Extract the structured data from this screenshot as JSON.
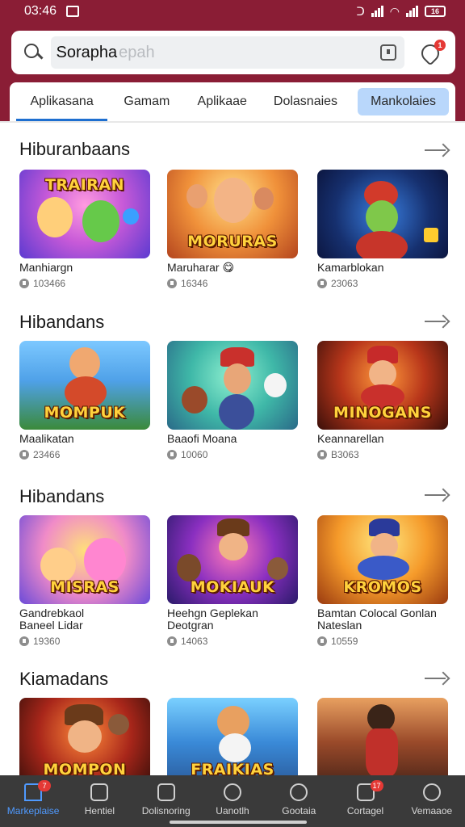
{
  "status_bar": {
    "time": "03:46",
    "battery": "16"
  },
  "search": {
    "value": "Sorapha",
    "placeholder": "epah",
    "notif_count": "1"
  },
  "tabs": [
    "Aplikasana",
    "Gamam",
    "Aplikaae",
    "Dolasnaies",
    "Mankolaies"
  ],
  "sections": [
    {
      "title": "Hiburanbaans",
      "cards": [
        {
          "name": "Manhiargn",
          "count": "103466",
          "art": "TRAIRAN"
        },
        {
          "name": "Maruharar 😋",
          "count": "16346",
          "art": "MORURAS"
        },
        {
          "name": "Kamarblokan",
          "count": "23063",
          "art": ""
        }
      ]
    },
    {
      "title": "Hibandans",
      "cards": [
        {
          "name": "Maalikatan",
          "count": "23466",
          "art": "MOMPUK"
        },
        {
          "name": "Baaofi Moana",
          "count": "10060",
          "art": ""
        },
        {
          "name": "Keannarellan",
          "count": "B3063",
          "art": "MINOGANS"
        }
      ]
    },
    {
      "title": "Hibandans",
      "cards": [
        {
          "name": "Gandrebkaol\nBaneel Lidar",
          "count": "19360",
          "art": "MISRAS"
        },
        {
          "name": "Heehgn Geplekan\nDeotgran",
          "count": "14063",
          "art": "MOKIAUK"
        },
        {
          "name": "Bamtan Colocal Gonlan\nNateslan",
          "count": "10559",
          "art": "KROMOS"
        }
      ]
    },
    {
      "title": "Kiamadans",
      "cards": [
        {
          "name": "",
          "count": "",
          "art": "MOMPON"
        },
        {
          "name": "",
          "count": "",
          "art": "FRAIKIAS"
        },
        {
          "name": "",
          "count": "",
          "art": ""
        }
      ]
    }
  ],
  "bottom_nav": [
    {
      "label": "Markeplaise",
      "badge": "7"
    },
    {
      "label": "Hentiel",
      "badge": ""
    },
    {
      "label": "Dolisnoring",
      "badge": ""
    },
    {
      "label": "Uanotlh",
      "badge": ""
    },
    {
      "label": "Gootaia",
      "badge": ""
    },
    {
      "label": "Cortagel",
      "badge": "17"
    },
    {
      "label": "Vemaaoe",
      "badge": ""
    }
  ],
  "colors": {
    "header": "#8a1d35",
    "accent": "#1e6fd0",
    "active_tab_bg": "#b9d7fb",
    "nav_bg": "#3a3a3a"
  }
}
